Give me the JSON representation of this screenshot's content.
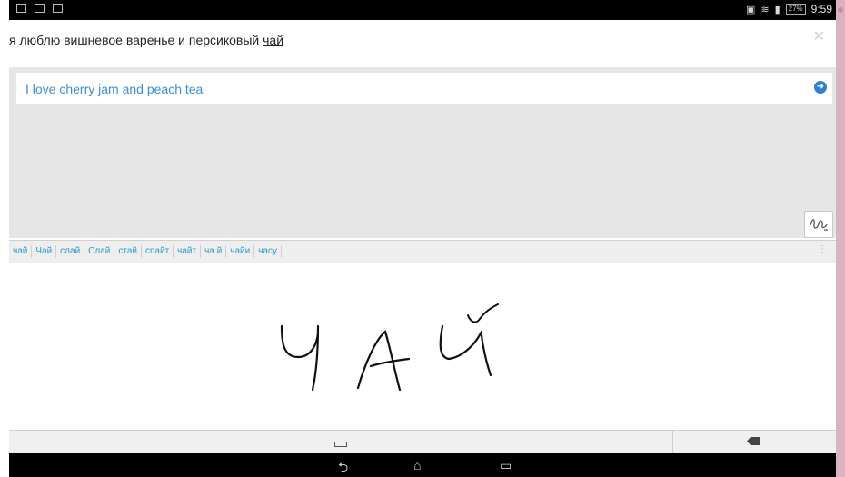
{
  "status": {
    "time": "9:59",
    "battery": "27%",
    "icons": [
      "notification-icon",
      "photo-icon",
      "briefcase-icon"
    ],
    "right_icons": [
      "sim-icon",
      "wifi-icon",
      "signal-icon"
    ]
  },
  "input": {
    "text_before": "я люблю вишневое варенье и персиковый ",
    "text_underlined": "чай"
  },
  "translation": {
    "text": "I love cherry jam and peach tea"
  },
  "suggestions": [
    "чай",
    "Чай",
    "слай",
    "Слай",
    "стай",
    "спайт",
    "чайт",
    "ча й",
    "чайи",
    "часу"
  ],
  "handwriting": {
    "strokes_text": "ЧАЙ"
  },
  "nav": {
    "back": "⮌",
    "home": "⌂",
    "recents": "▭"
  }
}
